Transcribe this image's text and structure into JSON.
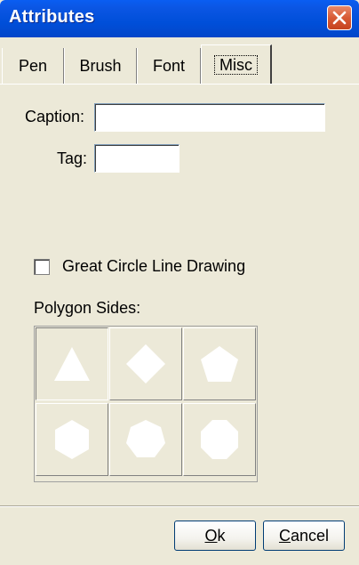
{
  "window": {
    "title": "Attributes"
  },
  "tabs": [
    {
      "label": "Pen"
    },
    {
      "label": "Brush"
    },
    {
      "label": "Font"
    },
    {
      "label": "Misc"
    }
  ],
  "form": {
    "caption_label": "Caption:",
    "caption_value": "",
    "tag_label": "Tag:",
    "tag_value": "",
    "great_circle_label": "Great Circle Line Drawing",
    "great_circle_checked": false,
    "polygon_sides_label": "Polygon Sides:"
  },
  "polygon_sides": {
    "options": [
      3,
      4,
      5,
      6,
      7,
      8
    ],
    "selected": 3
  },
  "buttons": {
    "ok_label": "Ok",
    "ok_mnemonic": "O",
    "ok_rest": "k",
    "cancel_label": "Cancel",
    "cancel_mnemonic": "C",
    "cancel_rest": "ancel"
  },
  "icons": [
    "close-icon",
    "triangle-icon",
    "diamond-icon",
    "pentagon-icon",
    "hexagon-icon",
    "heptagon-icon",
    "octagon-icon"
  ]
}
